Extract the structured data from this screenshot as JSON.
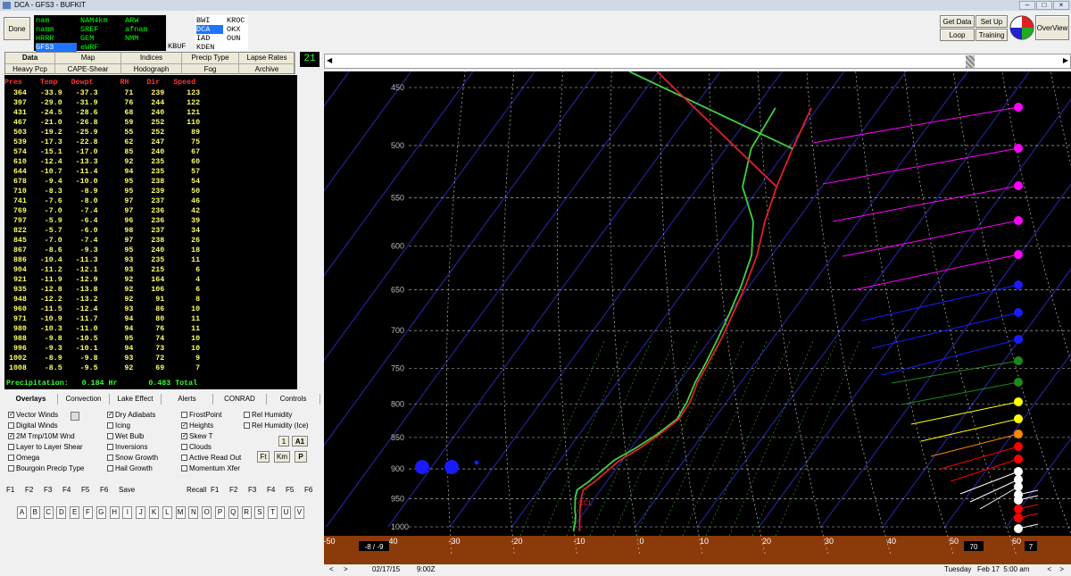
{
  "window": {
    "title": "DCA - GFS3 - BUFKIT"
  },
  "buttons": {
    "done": "Done",
    "get_data": "Get Data",
    "set_up": "Set Up",
    "loop": "Loop",
    "training": "Training",
    "overview": "OverView"
  },
  "models": [
    {
      "label": "nam",
      "col": 0,
      "row": 0,
      "color": "green"
    },
    {
      "label": "NAM4km",
      "col": 1,
      "row": 0,
      "color": "green"
    },
    {
      "label": "ARW",
      "col": 2,
      "row": 0,
      "color": "green"
    },
    {
      "label": "namm",
      "col": 0,
      "row": 1,
      "color": "green"
    },
    {
      "label": "SREF",
      "col": 1,
      "row": 1,
      "color": "green"
    },
    {
      "label": "afnam",
      "col": 2,
      "row": 1,
      "color": "green"
    },
    {
      "label": "HRRR",
      "col": 0,
      "row": 2,
      "color": "green"
    },
    {
      "label": "GEM",
      "col": 1,
      "row": 2,
      "color": "green"
    },
    {
      "label": "NMM",
      "col": 2,
      "row": 2,
      "color": "green"
    },
    {
      "label": "GFS3",
      "col": 0,
      "row": 3,
      "color": "selected"
    },
    {
      "label": "eWRF",
      "col": 1,
      "row": 3,
      "color": "green"
    }
  ],
  "stations": [
    {
      "label": "BWI",
      "col": 0,
      "row": 0
    },
    {
      "label": "KROC",
      "col": 1,
      "row": 0
    },
    {
      "label": "DCA",
      "col": 0,
      "row": 1,
      "selected": true
    },
    {
      "label": "OKX",
      "col": 1,
      "row": 1
    },
    {
      "label": "IAD",
      "col": 0,
      "row": 2
    },
    {
      "label": "OUN",
      "col": 1,
      "row": 2
    },
    {
      "label": "KDEN",
      "col": 0,
      "row": 3
    }
  ],
  "station_extra": "KBUF",
  "forecast_hour": "21",
  "tabs_row1": [
    "Data",
    "Map",
    "Indices",
    "Precip Type",
    "Lapse Rates"
  ],
  "tabs_row2": [
    "Heavy Pcp",
    "CAPE-Shear",
    "Hodograph",
    "Fog",
    "Archive"
  ],
  "table": {
    "header": "Pres    Temp   Dewpt      RH    Dir   Speed",
    "rows": [
      "  364   -33.9   -37.3      71    239     123",
      "  397   -29.0   -31.9      76    244     122",
      "  431   -24.5   -28.6      68    240     121",
      "  467   -21.0   -26.8      59    252     110",
      "  503   -19.2   -25.9      55    252      89",
      "  539   -17.3   -22.8      62    247      75",
      "  574   -15.1   -17.0      85    240      67",
      "  610   -12.4   -13.3      92    235      60",
      "  644   -10.7   -11.4      94    235      57",
      "  678    -9.4   -10.0      95    238      54",
      "  710    -8.3    -8.9      95    239      50",
      "  741    -7.6    -8.0      97    237      46",
      "  769    -7.0    -7.4      97    236      42",
      "  797    -5.9    -6.4      96    236      39",
      "  822    -5.7    -6.0      98    237      34",
      "  845    -7.0    -7.4      97    238      26",
      "  867    -8.6    -9.3      95    240      18",
      "  886   -10.4   -11.3      93    235      11",
      "  904   -11.2   -12.1      93    215       6",
      "  921   -11.9   -12.9      92    164       4",
      "  935   -12.8   -13.8      92    106       6",
      "  948   -12.2   -13.2      92     91       8",
      "  960   -11.5   -12.4      93     86      10",
      "  971   -10.9   -11.7      94     80      11",
      "  980   -10.3   -11.0      94     76      11",
      "  988    -9.8   -10.5      95     74      10",
      "  996    -9.3   -10.1      94     73      10",
      " 1002    -8.9    -9.8      93     72       9",
      " 1008    -8.5    -9.5      92     69       7"
    ],
    "precip": "Precipitation:   0.184 Hr       0.483 Total"
  },
  "overlay_tabs": [
    "Overlays",
    "Convection",
    "Lake Effect",
    "Alerts",
    "CONRAD",
    "Controls"
  ],
  "checkboxes": [
    {
      "label": "Vector Winds",
      "checked": true,
      "col": 0,
      "row": 0
    },
    {
      "label": "Digital Winds",
      "checked": false,
      "col": 0,
      "row": 1
    },
    {
      "label": "2M Tmp/10M Wnd",
      "checked": true,
      "col": 0,
      "row": 2
    },
    {
      "label": "Layer to Layer Shear",
      "checked": false,
      "col": 0,
      "row": 3
    },
    {
      "label": "Omega",
      "checked": false,
      "col": 0,
      "row": 4
    },
    {
      "label": "Bourgoin Precip Type",
      "checked": false,
      "col": 0,
      "row": 5
    },
    {
      "label": "Dry Adiabats",
      "checked": true,
      "col": 1,
      "row": 0
    },
    {
      "label": "Icing",
      "checked": false,
      "col": 1,
      "row": 1
    },
    {
      "label": "Wet Bulb",
      "checked": false,
      "col": 1,
      "row": 2
    },
    {
      "label": "Inversions",
      "checked": false,
      "col": 1,
      "row": 3
    },
    {
      "label": "Snow Growth",
      "checked": false,
      "col": 1,
      "row": 4
    },
    {
      "label": "Hail Growth",
      "checked": false,
      "col": 1,
      "row": 5
    },
    {
      "label": "FrostPoint",
      "checked": false,
      "col": 2,
      "row": 0
    },
    {
      "label": "Heights",
      "checked": true,
      "col": 2,
      "row": 1
    },
    {
      "label": "Skew T",
      "checked": true,
      "col": 2,
      "row": 2
    },
    {
      "label": "Clouds",
      "checked": false,
      "col": 2,
      "row": 3
    },
    {
      "label": "Active Read Out",
      "checked": false,
      "col": 2,
      "row": 4
    },
    {
      "label": "Momentum Xfer",
      "checked": false,
      "col": 2,
      "row": 5
    },
    {
      "label": "Rel Humidity",
      "checked": false,
      "col": 3,
      "row": 0
    },
    {
      "label": "Rel Humidity (Ice)",
      "checked": false,
      "col": 3,
      "row": 1
    }
  ],
  "small_buttons": {
    "one": "1",
    "a1": "A1",
    "ft": "Ft",
    "km": "Km",
    "p": "P"
  },
  "fkeys_left": [
    "F1",
    "F2",
    "F3",
    "F4",
    "F5",
    "F6"
  ],
  "save_label": "Save",
  "recall_label": "Recall",
  "fkeys_right": [
    "F1",
    "F2",
    "F3",
    "F4",
    "F5",
    "F6"
  ],
  "letters": [
    "A",
    "B",
    "C",
    "D",
    "E",
    "F",
    "G",
    "H",
    "I",
    "J",
    "K",
    "L",
    "M",
    "N",
    "O",
    "P",
    "Q",
    "R",
    "S",
    "T",
    "U",
    "V"
  ],
  "plot": {
    "pressure_labels": [
      "450",
      "500",
      "550",
      "600",
      "650",
      "700",
      "750",
      "800",
      "850",
      "900",
      "950",
      "1000"
    ],
    "temp_labels": [
      "-50",
      "-40",
      "-30",
      "-20",
      "-10",
      "0",
      "10",
      "20",
      "30",
      "40",
      "50",
      "60"
    ],
    "ccl_label": "CCL",
    "sfc_readout": "-8 / -9",
    "readout_70": "70",
    "readout_7": "7",
    "temperature_c": [
      -33.9,
      -29.0,
      -24.5,
      -21.0,
      -19.2,
      -17.3,
      -15.1,
      -12.4,
      -10.7,
      -9.4,
      -8.3,
      -7.6,
      -7.0,
      -5.9,
      -5.7,
      -7.0,
      -8.6,
      -10.4,
      -11.2,
      -11.9,
      -12.8,
      -12.2,
      -11.5,
      -10.9,
      -10.3,
      -9.8,
      -9.3,
      -8.9,
      -8.5
    ],
    "dewpoint_c": [
      -37.3,
      -31.9,
      -28.6,
      -26.8,
      -25.9,
      -22.8,
      -17.0,
      -13.3,
      -11.4,
      -10.0,
      -8.9,
      -8.0,
      -7.4,
      -6.4,
      -6.0,
      -7.4,
      -9.3,
      -11.3,
      -12.1,
      -12.9,
      -13.8,
      -13.2,
      -12.4,
      -11.7,
      -11.0,
      -10.5,
      -10.1,
      -9.8,
      -9.5
    ],
    "pressure_hpa": [
      364,
      397,
      431,
      467,
      503,
      539,
      574,
      610,
      644,
      678,
      710,
      741,
      769,
      797,
      822,
      845,
      867,
      886,
      904,
      921,
      935,
      948,
      960,
      971,
      980,
      988,
      996,
      1002,
      1008
    ],
    "wind_speed_kt": [
      123,
      122,
      121,
      110,
      89,
      75,
      67,
      60,
      57,
      54,
      50,
      46,
      42,
      39,
      34,
      26,
      18,
      11,
      6,
      4,
      6,
      8,
      10,
      11,
      11,
      10,
      10,
      9,
      7
    ],
    "colors": {
      "temp": "#e0202a",
      "dewpt": "#40d040",
      "ground": "#8b3a0a",
      "grid": "#cccccc"
    }
  },
  "status": {
    "date": "02/17/15",
    "time": "9:00Z",
    "valid": "Tuesday   Feb 17  5:00 am"
  }
}
